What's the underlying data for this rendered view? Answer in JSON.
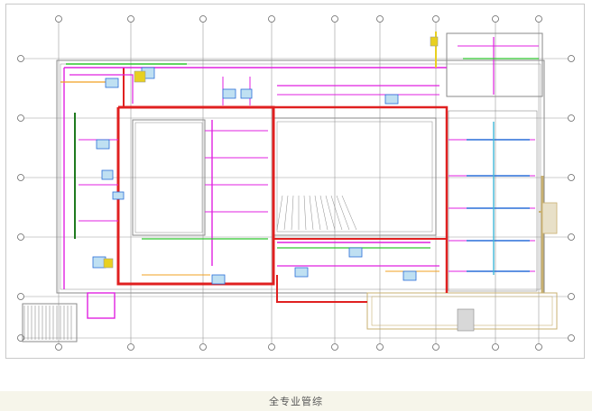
{
  "caption": "全专业管综",
  "colors": {
    "grid": "#9a9a9a",
    "wall": "#8a8a8a",
    "magenta": "#e021e0",
    "red": "#e02020",
    "green": "#2ec52e",
    "darkgreen": "#1f7a1f",
    "blue": "#2a6fd8",
    "orange": "#f0a020",
    "yellow": "#e8d020",
    "cyan": "#40b8d8",
    "tan": "#c8b070"
  }
}
